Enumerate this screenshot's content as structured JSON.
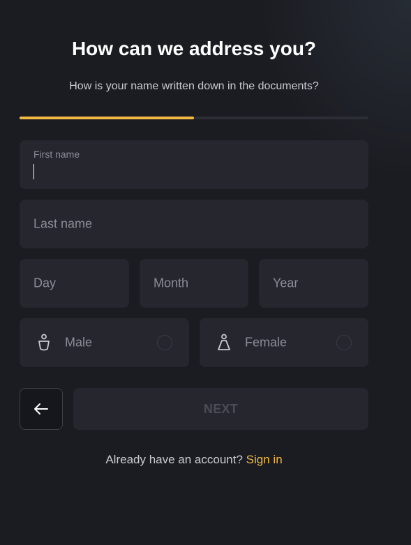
{
  "header": {
    "title": "How can we address you?",
    "subtitle": "How is your name written down in the documents?"
  },
  "progress": {
    "fraction": 0.5,
    "color": "#f4b942"
  },
  "form": {
    "first_name": {
      "label": "First name",
      "value": ""
    },
    "last_name": {
      "placeholder": "Last name"
    },
    "day": {
      "placeholder": "Day"
    },
    "month": {
      "placeholder": "Month"
    },
    "year": {
      "placeholder": "Year"
    },
    "gender": {
      "male": {
        "label": "Male",
        "icon": "male-icon",
        "selected": false
      },
      "female": {
        "label": "Female",
        "icon": "female-icon",
        "selected": false
      }
    }
  },
  "actions": {
    "back_icon": "arrow-left-icon",
    "next_label": "NEXT"
  },
  "footer": {
    "prompt": "Already have an account?",
    "link": "Sign in"
  },
  "colors": {
    "accent": "#f4b942",
    "background": "#1b1c22",
    "field": "#25262e"
  }
}
